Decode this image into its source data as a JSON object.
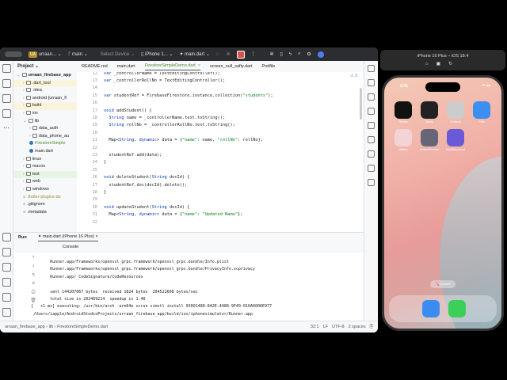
{
  "toolbar": {
    "project": "urraan...",
    "project_badge": "UA",
    "branch": "main",
    "device_select": "Select Device",
    "device": "iPhone 1...",
    "run_config": "main.dart"
  },
  "project_panel": {
    "title": "Project",
    "items": [
      {
        "label": "urraan_firebase_app",
        "depth": 0,
        "kind": "root"
      },
      {
        "label": ".dart_tool",
        "depth": 1,
        "kind": "folder",
        "hl": "yel"
      },
      {
        "label": ".idea",
        "depth": 1,
        "kind": "folder"
      },
      {
        "label": "android [urraan_fi",
        "depth": 1,
        "kind": "folder"
      },
      {
        "label": "build",
        "depth": 1,
        "kind": "folder",
        "hl": "yel"
      },
      {
        "label": "ios",
        "depth": 1,
        "kind": "folder"
      },
      {
        "label": "lib",
        "depth": 1,
        "kind": "folder"
      },
      {
        "label": "data_auth",
        "depth": 2,
        "kind": "folder"
      },
      {
        "label": "data_phone_au",
        "depth": 2,
        "kind": "folder"
      },
      {
        "label": "FirestoreSimple",
        "depth": 2,
        "kind": "dart"
      },
      {
        "label": "main.dart",
        "depth": 2,
        "kind": "dart"
      },
      {
        "label": "linux",
        "depth": 1,
        "kind": "folder"
      },
      {
        "label": "macos",
        "depth": 1,
        "kind": "folder"
      },
      {
        "label": "test",
        "depth": 1,
        "kind": "folder",
        "hl": "grn"
      },
      {
        "label": "web",
        "depth": 1,
        "kind": "folder"
      },
      {
        "label": "windows",
        "depth": 1,
        "kind": "folder"
      },
      {
        "label": ".flutter-plugins-de",
        "depth": 1,
        "kind": "file"
      },
      {
        "label": ".gitignore",
        "depth": 1,
        "kind": "file"
      },
      {
        "label": ".metadata",
        "depth": 1,
        "kind": "file"
      }
    ]
  },
  "tabs": [
    "README.md",
    "main.dart",
    "FirestoreSimpleDemo.dart",
    "screen_null_safty.dart",
    "Podfile"
  ],
  "active_tab": 2,
  "editor": {
    "warnings": "⚠ 3",
    "lines": [
      {
        "n": "12",
        "t": "var _controllerName = TextEditingController();"
      },
      {
        "n": "13",
        "t": "var _controllerRollNo = TextEditingController();"
      },
      {
        "n": "14",
        "t": ""
      },
      {
        "n": "15",
        "t": "var studentRef = FirebaseFirestore.instance.collection(\"students\");"
      },
      {
        "n": "16",
        "t": ""
      },
      {
        "n": "17",
        "t": "void addStudent() {"
      },
      {
        "n": "18",
        "t": "  String name = _controllerName.text.toString();"
      },
      {
        "n": "19",
        "t": "  String rollNo = _controllerRollNo.text.toString();"
      },
      {
        "n": "20",
        "t": ""
      },
      {
        "n": "21",
        "t": "  Map<String, dynamic> data = {\"name\": name, \"rollNo\": rollNo};"
      },
      {
        "n": "22",
        "t": ""
      },
      {
        "n": "23",
        "t": "  studentRef.add(data);"
      },
      {
        "n": "24",
        "t": "}"
      },
      {
        "n": "25",
        "t": ""
      },
      {
        "n": "26",
        "t": "void deleteStudent(String docId) {"
      },
      {
        "n": "27",
        "t": "  studentRef.doc(docId).delete();"
      },
      {
        "n": "28",
        "t": "}"
      },
      {
        "n": "29",
        "t": ""
      },
      {
        "n": "30",
        "t": "void updateStudent(String docId) {"
      },
      {
        "n": "31",
        "t": "  Map<String, dynamic> data = {\"name\": \"Updated Name\"};"
      },
      {
        "n": "32",
        "t": ""
      }
    ]
  },
  "run": {
    "label": "Run",
    "tab": "main.dart (iPhone 16 Plus)",
    "console_label": "Console",
    "lines": [
      "        Runner.app/Frameworks/openssl_grpc.framework/openssl_grpc.bundle/Info.plist",
      "        Runner.app/Frameworks/openssl_grpc.framework/openssl_grpc.bundle/PrivacyInfo.xcprivacy",
      "        Runner.app/_CodeSignature/CodeResources",
      "",
      "        sent 144207067 bytes  received 1824 bytes  204522608 bytes/sec",
      "        total size is 202469214  speedup is 1.40",
      "[   +1 ms] executing: /usr/bin/arch -arm64e xcrun simctl install 93001488-842E-4088-9F40-010A6006E977",
      " /Users/iapple/AndroidStudioProjects/urraan_firebase_app/build/ios/iphonesimulator/Runner.app"
    ]
  },
  "status": {
    "crumbs": [
      "urraan_firebase_app",
      "lib",
      "FirestoreSimpleDemo.dart"
    ],
    "position": "32:1",
    "line_sep": "LF",
    "encoding": "UTF-8",
    "indent": "2 spaces"
  },
  "simulator": {
    "title": "iPhone 16 Plus – iOS 18.4",
    "time": "2:01",
    "search": "🔍 Search",
    "apps": [
      {
        "label": "Fitness",
        "color": "#111"
      },
      {
        "label": "Watch",
        "color": "#222"
      },
      {
        "label": "Contacts",
        "color": "#ccc"
      },
      {
        "label": "Files",
        "color": "#3b8ff0"
      },
      {
        "label": "Utilities",
        "color": "#f3d3d6"
      },
      {
        "label": "UrraanFirebase...",
        "color": "#667"
      },
      {
        "label": "MetaDiscoveryPl...",
        "color": "#6a5ad8"
      }
    ],
    "dock": [
      {
        "label": "Safari",
        "color": "#3a8cf0"
      },
      {
        "label": "Messages",
        "color": "#3ccf5a"
      }
    ]
  }
}
